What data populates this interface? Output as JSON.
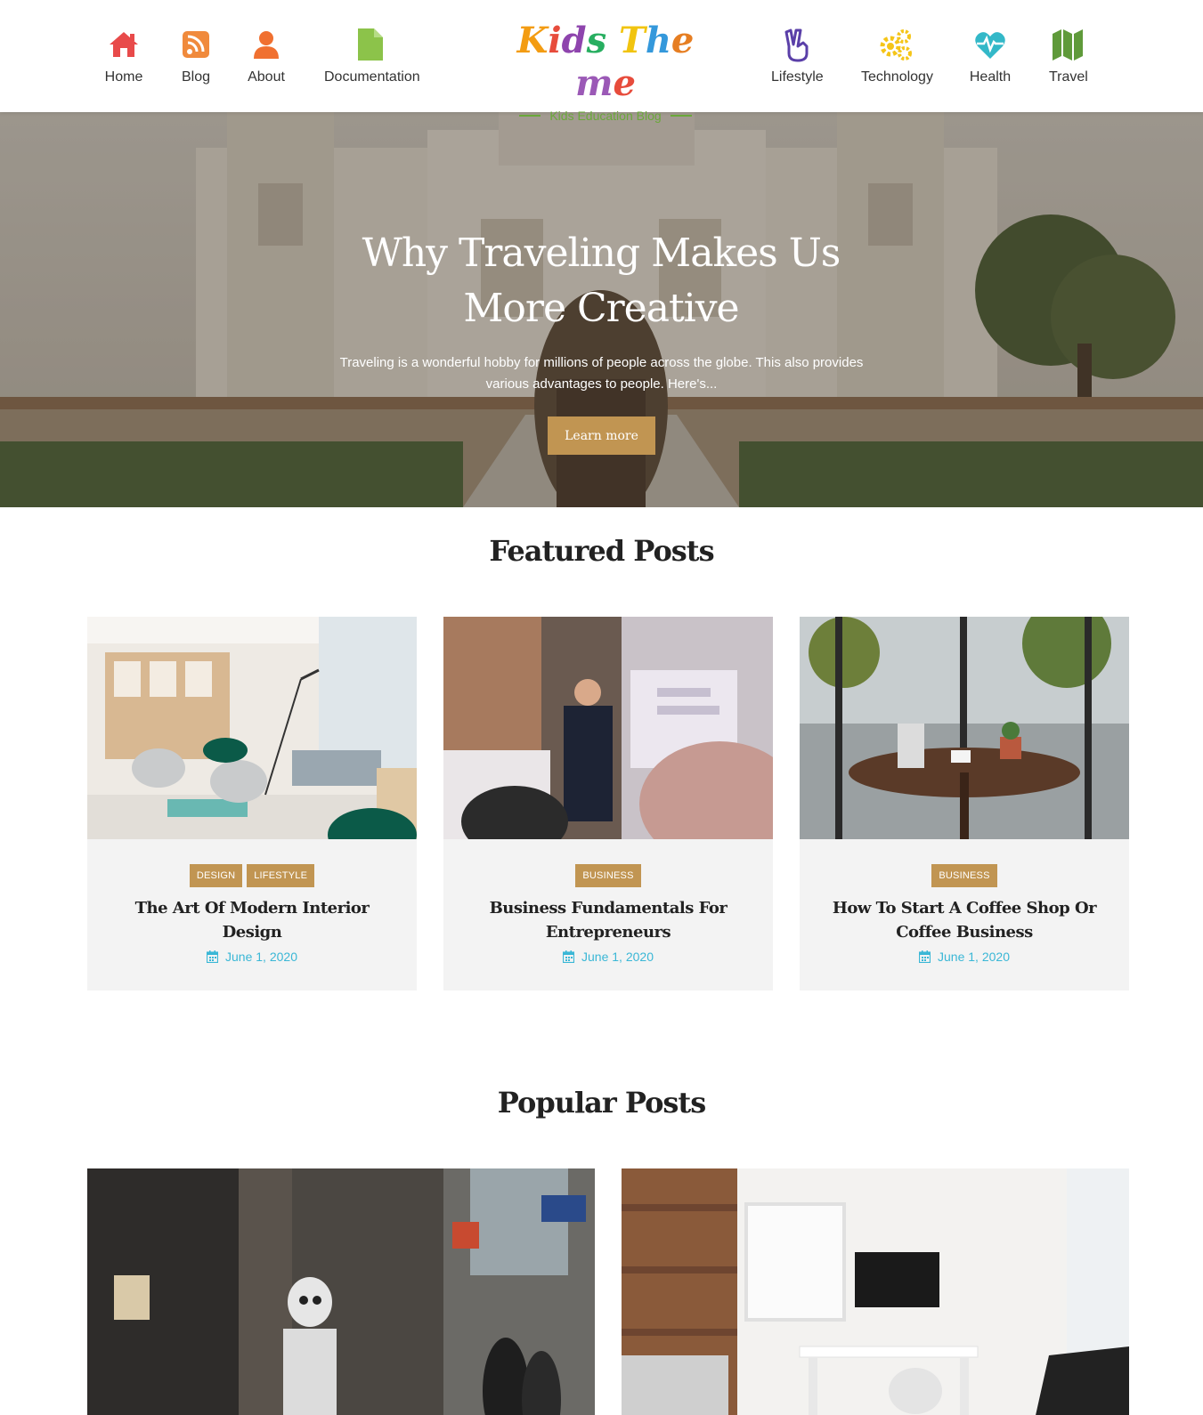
{
  "nav_left": [
    {
      "label": "Home",
      "icon": "home-icon",
      "color": "#e84a4a"
    },
    {
      "label": "Blog",
      "icon": "rss-icon",
      "color": "#f08a3c"
    },
    {
      "label": "About",
      "icon": "user-icon",
      "color": "#f07030"
    },
    {
      "label": "Documentation",
      "icon": "file-icon",
      "color": "#8cc34a"
    }
  ],
  "nav_right": [
    {
      "label": "Lifestyle",
      "icon": "hand-peace-icon",
      "color": "#5a3fa8"
    },
    {
      "label": "Technology",
      "icon": "cogs-icon",
      "color": "#f5c518"
    },
    {
      "label": "Health",
      "icon": "heartbeat-icon",
      "color": "#33b8c8"
    },
    {
      "label": "Travel",
      "icon": "map-icon",
      "color": "#5f9a3a"
    }
  ],
  "logo": {
    "letters": [
      "K",
      "i",
      "d",
      "s",
      " ",
      "T",
      "h",
      "e",
      "m",
      "e"
    ],
    "letter_colors": [
      "#f39c12",
      "#e74c3c",
      "#8e44ad",
      "#27ae60",
      "#ffffff",
      "#f1c40f",
      "#3498db",
      "#e67e22",
      "#9b59b6",
      "#e74c3c"
    ],
    "subtitle": "Kids Education Blog"
  },
  "hero": {
    "title": "Why Traveling Makes Us More Creative",
    "description": "Traveling is a wonderful hobby for millions of people across the globe. This also provides various advantages to people. Here's...",
    "button": "Learn more"
  },
  "featured": {
    "title": "Featured Posts",
    "posts": [
      {
        "tags": [
          "DESIGN",
          "LIFESTYLE"
        ],
        "title": "The Art Of Modern Interior Design",
        "date": "June 1, 2020"
      },
      {
        "tags": [
          "BUSINESS"
        ],
        "title": "Business Fundamentals For Entrepreneurs",
        "date": "June 1, 2020"
      },
      {
        "tags": [
          "BUSINESS"
        ],
        "title": "How To Start A Coffee Shop Or Coffee Business",
        "date": "June 1, 2020"
      }
    ]
  },
  "popular": {
    "title": "Popular Posts"
  },
  "colors": {
    "accent": "#c19552",
    "date": "#3ab7d6"
  }
}
